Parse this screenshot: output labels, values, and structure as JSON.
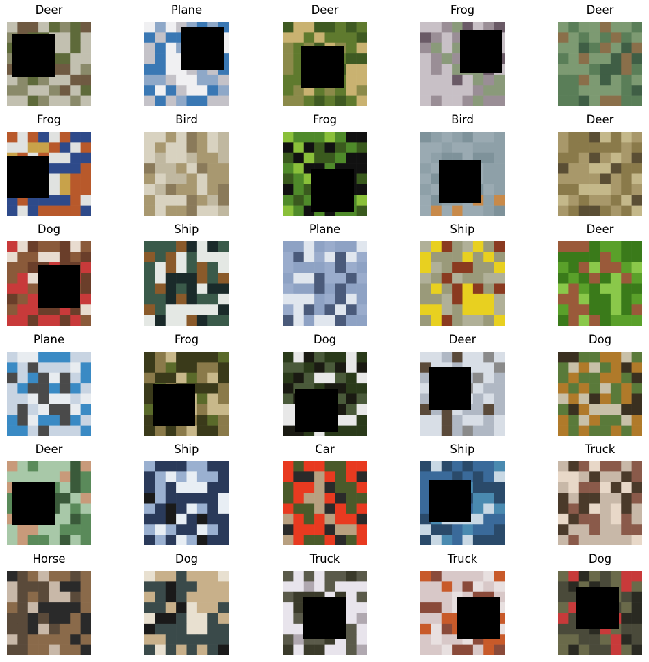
{
  "grid": {
    "rows": 6,
    "cols": 5,
    "cells": [
      {
        "label": "Deer",
        "palette": [
          "#8a8a6a",
          "#c2c0b0",
          "#5e6a3a",
          "#6f5a42"
        ],
        "occluded": true
      },
      {
        "label": "Plane",
        "palette": [
          "#c4c2c8",
          "#3a78b4",
          "#f0f0f2",
          "#8ea8c8"
        ],
        "occluded": true
      },
      {
        "label": "Deer",
        "palette": [
          "#5f7a2e",
          "#c9b271",
          "#3f5a22",
          "#8b8a4a"
        ],
        "occluded": true
      },
      {
        "label": "Frog",
        "palette": [
          "#9a8e96",
          "#c8c0c6",
          "#8a9a7a",
          "#6a5a66"
        ],
        "occluded": true
      },
      {
        "label": "Deer",
        "palette": [
          "#5a7e58",
          "#7d9a72",
          "#8a6f4a",
          "#3f5e45"
        ],
        "occluded": false
      },
      {
        "label": "Frog",
        "palette": [
          "#b8592b",
          "#2e4a8a",
          "#e0e2e0",
          "#c8a24a"
        ],
        "occluded": true
      },
      {
        "label": "Bird",
        "palette": [
          "#d8d2c0",
          "#a89870",
          "#c0b8a0",
          "#8a7a5a"
        ],
        "occluded": false
      },
      {
        "label": "Frog",
        "palette": [
          "#4f8a2a",
          "#111111",
          "#8ac03a",
          "#3a5a1e"
        ],
        "occluded": true
      },
      {
        "label": "Bird",
        "palette": [
          "#8ea0a8",
          "#9aaab2",
          "#c88a4a",
          "#7e929a"
        ],
        "occluded": true
      },
      {
        "label": "Deer",
        "palette": [
          "#8a7a4a",
          "#a8986a",
          "#c4b88a",
          "#5a4e34"
        ],
        "occluded": false
      },
      {
        "label": "Dog",
        "palette": [
          "#c83a3a",
          "#6a3e2a",
          "#e8dcd0",
          "#8a5a3a"
        ],
        "occluded": true
      },
      {
        "label": "Ship",
        "palette": [
          "#3a5a4a",
          "#e4e8e4",
          "#8a5a2a",
          "#1a2a2a"
        ],
        "occluded": false
      },
      {
        "label": "Plane",
        "palette": [
          "#8ea2c4",
          "#e0e6ee",
          "#9aaccc",
          "#4a5a7a"
        ],
        "occluded": false
      },
      {
        "label": "Ship",
        "palette": [
          "#9a9a7a",
          "#e8d020",
          "#8a3a20",
          "#b0b098"
        ],
        "occluded": false
      },
      {
        "label": "Deer",
        "palette": [
          "#5aa02a",
          "#3a7a1a",
          "#8ac84a",
          "#9a5a3a"
        ],
        "occluded": false
      },
      {
        "label": "Plane",
        "palette": [
          "#c8d4e2",
          "#3a8ac4",
          "#4a4a4a",
          "#e8ecf0"
        ],
        "occluded": false
      },
      {
        "label": "Frog",
        "palette": [
          "#3a3a1a",
          "#8a7a4a",
          "#c8b88a",
          "#5a6a2a"
        ],
        "occluded": true
      },
      {
        "label": "Dog",
        "palette": [
          "#2a3a1a",
          "#e8e8e8",
          "#4a5a3a",
          "#1a1a12"
        ],
        "occluded": true
      },
      {
        "label": "Deer",
        "palette": [
          "#b0b8c4",
          "#d8dee6",
          "#5a4a3a",
          "#8a8a8a"
        ],
        "occluded": true
      },
      {
        "label": "Dog",
        "palette": [
          "#b07a2a",
          "#5a7a3a",
          "#c8c0a8",
          "#3a3020"
        ],
        "occluded": false
      },
      {
        "label": "Deer",
        "palette": [
          "#5a8a5a",
          "#a8c8a8",
          "#c89a7a",
          "#3a5a3a"
        ],
        "occluded": true
      },
      {
        "label": "Ship",
        "palette": [
          "#9ab0d0",
          "#2a3a5a",
          "#e8eef4",
          "#1a1a1a"
        ],
        "occluded": false
      },
      {
        "label": "Car",
        "palette": [
          "#e83a20",
          "#4a5a2a",
          "#b8a080",
          "#2a2a2a"
        ],
        "occluded": false
      },
      {
        "label": "Ship",
        "palette": [
          "#3a6a9a",
          "#2a4a6a",
          "#c8d8e4",
          "#4a8ab0"
        ],
        "occluded": true
      },
      {
        "label": "Truck",
        "palette": [
          "#8a5a4a",
          "#c8b8a8",
          "#4a3a2a",
          "#e8d8c8"
        ],
        "occluded": false
      },
      {
        "label": "Horse",
        "palette": [
          "#5a4a3a",
          "#8a6a4a",
          "#2a2a2a",
          "#c8b8a8"
        ],
        "occluded": false
      },
      {
        "label": "Dog",
        "palette": [
          "#c8b08a",
          "#3a4a4a",
          "#e8e0d0",
          "#1a1a1a"
        ],
        "occluded": false
      },
      {
        "label": "Truck",
        "palette": [
          "#e8e4ec",
          "#5a5a4a",
          "#b0a8b0",
          "#3a3a2a"
        ],
        "occluded": true
      },
      {
        "label": "Truck",
        "palette": [
          "#d8c8c8",
          "#c85a2a",
          "#8a4a3a",
          "#e8e0e0"
        ],
        "occluded": true
      },
      {
        "label": "Dog",
        "palette": [
          "#4a4a3a",
          "#6a6a4a",
          "#c83a3a",
          "#2a2a22"
        ],
        "occluded": true
      }
    ]
  }
}
